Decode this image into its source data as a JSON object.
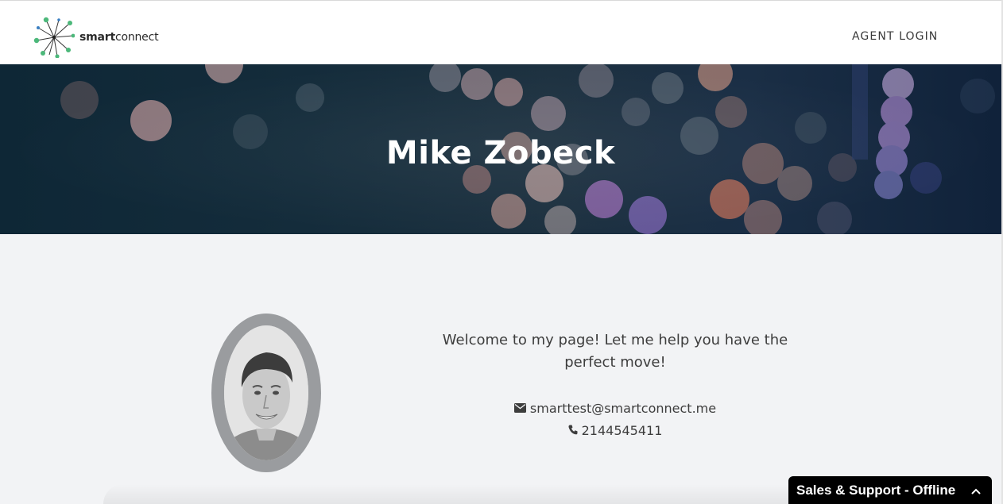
{
  "header": {
    "logo": {
      "bold_part": "smart",
      "normal_part": "connect",
      "icon": "starburst-logo-icon"
    },
    "nav": {
      "agent_login": "AGENT LOGIN"
    }
  },
  "hero": {
    "title": "Mike Zobeck",
    "background": "bokeh-lights-photo"
  },
  "profile": {
    "photo": "agent-portrait-photo",
    "welcome": "Welcome to my page! Let me help you have the perfect move!",
    "email": "smarttest@smartconnect.me",
    "email_icon": "envelope-icon",
    "phone": "2144545411",
    "phone_icon": "phone-icon"
  },
  "chat_widget": {
    "label": "Sales & Support - Offline",
    "icon": "chevron-up-icon"
  },
  "colors": {
    "logo_green": "#4cb87a",
    "hero_dark": "#142c3b",
    "page_bg": "#f2f3f5",
    "avatar_ring": "#9a9c9f",
    "chat_bg": "#000000"
  }
}
